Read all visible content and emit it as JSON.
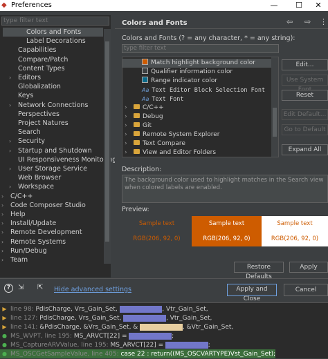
{
  "window": {
    "title": "Preferences",
    "minimize": "—",
    "maximize": "☐",
    "close": "✕"
  },
  "left": {
    "filter_placeholder": "type filter text",
    "tree": [
      {
        "label": "Colors and Fonts",
        "level": 2,
        "selected": true
      },
      {
        "label": "Label Decorations",
        "level": 2
      },
      {
        "label": "Capabilities",
        "level": 1
      },
      {
        "label": "Compare/Patch",
        "level": 1
      },
      {
        "label": "Content Types",
        "level": 1
      },
      {
        "label": "Editors",
        "level": 1,
        "expandable": true
      },
      {
        "label": "Globalization",
        "level": 1
      },
      {
        "label": "Keys",
        "level": 1
      },
      {
        "label": "Network Connections",
        "level": 1,
        "expandable": true
      },
      {
        "label": "Perspectives",
        "level": 1
      },
      {
        "label": "Project Natures",
        "level": 1
      },
      {
        "label": "Search",
        "level": 1
      },
      {
        "label": "Security",
        "level": 1,
        "expandable": true
      },
      {
        "label": "Startup and Shutdown",
        "level": 1,
        "expandable": true
      },
      {
        "label": "UI Responsiveness Monitoring",
        "level": 1
      },
      {
        "label": "User Storage Service",
        "level": 1,
        "expandable": true
      },
      {
        "label": "Web Browser",
        "level": 1
      },
      {
        "label": "Workspace",
        "level": 1,
        "expandable": true
      },
      {
        "label": "C/C++",
        "level": 0,
        "expandable": true
      },
      {
        "label": "Code Composer Studio",
        "level": 0,
        "expandable": true
      },
      {
        "label": "Help",
        "level": 0,
        "expandable": true
      },
      {
        "label": "Install/Update",
        "level": 0,
        "expandable": true
      },
      {
        "label": "Remote Development",
        "level": 0,
        "expandable": true
      },
      {
        "label": "Remote Systems",
        "level": 0,
        "expandable": true
      },
      {
        "label": "Run/Debug",
        "level": 0,
        "expandable": true
      },
      {
        "label": "Team",
        "level": 0,
        "expandable": true
      }
    ]
  },
  "page": {
    "title": "Colors and Fonts",
    "nav_back": "⇦",
    "nav_forward": "⇨",
    "menu": "⋮",
    "cf_label": "Colors and Fonts (? = any character, * = any string):",
    "cf_filter_placeholder": "type filter text",
    "cf_tree": [
      {
        "label": "Match highlight background color",
        "kind": "color",
        "color": "#ce5c00",
        "selected": true
      },
      {
        "label": "Qualifier information color",
        "kind": "color",
        "color": "#3c3f41"
      },
      {
        "label": "Range indicator color",
        "kind": "color",
        "color": "#0a6a8a"
      },
      {
        "label": "Text Editor Block Selection Font",
        "kind": "font"
      },
      {
        "label": "Text Font",
        "kind": "font"
      },
      {
        "label": "C/C++",
        "kind": "folder"
      },
      {
        "label": "Debug",
        "kind": "folder"
      },
      {
        "label": "Git",
        "kind": "folder"
      },
      {
        "label": "Remote System Explorer",
        "kind": "folder"
      },
      {
        "label": "Text Compare",
        "kind": "folder"
      },
      {
        "label": "View and Editor Folders",
        "kind": "folder"
      }
    ],
    "buttons": {
      "edit": "Edit...",
      "use_system_font": "Use System Font",
      "reset": "Reset",
      "edit_default": "Edit Default...",
      "go_to_default": "Go to Default",
      "expand_all": "Expand All"
    },
    "description_label": "Description:",
    "description": "The background color used to highlight matches in the Search view when colored labels are enabled.",
    "preview_label": "Preview:",
    "preview": [
      {
        "text": "Sample text",
        "rgb": "RGB(206, 92, 0)",
        "bg": "#3c3f41",
        "fg": "#ce5c00"
      },
      {
        "text": "Sample text",
        "rgb": "RGB(206, 92, 0)",
        "bg": "#ce5c00",
        "fg": "#ffffff"
      },
      {
        "text": "Sample text",
        "rgb": "RGB(206, 92, 0)",
        "bg": "#ffffff",
        "fg": "#ce5c00"
      }
    ],
    "restore_defaults": "Restore Defaults",
    "apply": "Apply"
  },
  "footer": {
    "help": "?",
    "hide_advanced": "Hide advanced settings",
    "apply_and_close": "Apply and Close",
    "cancel": "Cancel"
  },
  "console": [
    {
      "gutter": "line 98:",
      "a": "PdisCharge, Vrs_Gain_Set,",
      "b": ", Vtr_Gain_Set,"
    },
    {
      "gutter": "line 127:",
      "a": "PdisCharge, Vrs_Gain_Set,",
      "b": ", Vtr_Gain_Set,"
    },
    {
      "gutter": "line 141:",
      "a": "&PdisCharge, &Vrs_Gain_Set, &",
      "b": ", &Vtr_Gain_Set,"
    },
    {
      "gutter": "MS_WVPT, line 195:",
      "a": "MS_ARVCT[22] =",
      "b": ";"
    },
    {
      "gutter": "MS_CaptureARVValue, line 195:",
      "a": "MS_ARVCT[22] =",
      "b": ";"
    },
    {
      "gutter": "MS_OSCGetSampleValue, line 405:",
      "a": "case 22 : return((MS_OSCVARTYPE)Vst_Gain_Set);",
      "b": ""
    }
  ]
}
